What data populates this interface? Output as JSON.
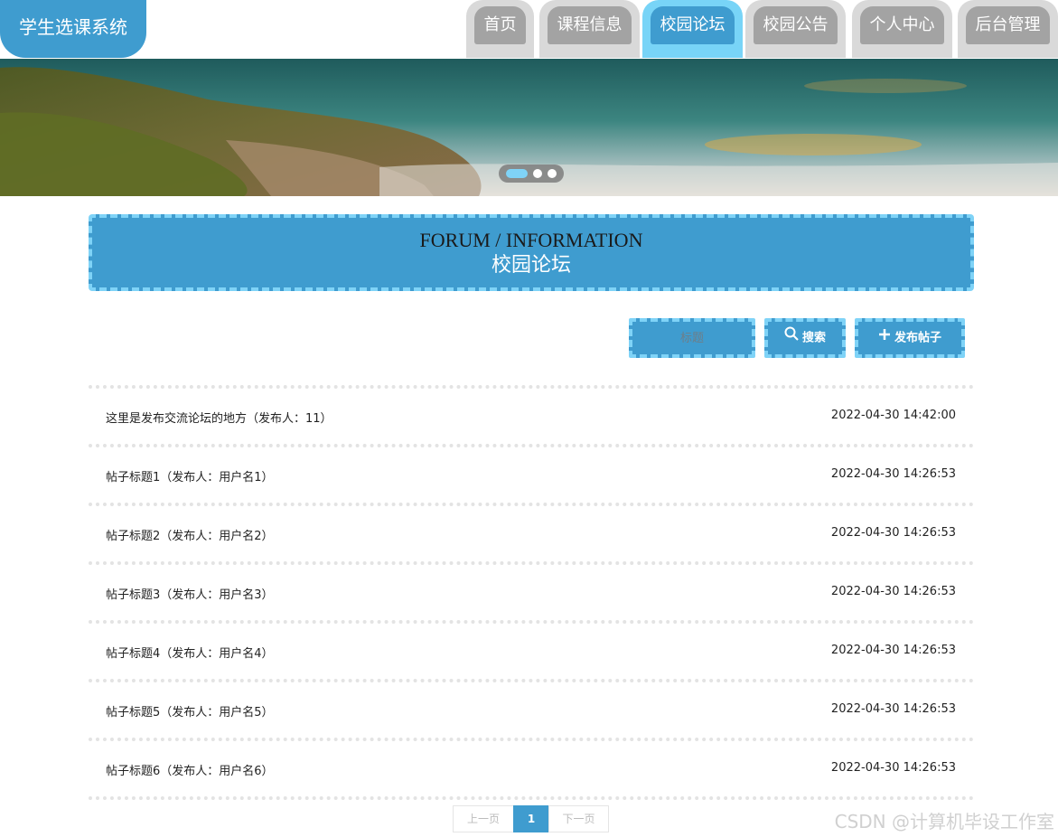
{
  "header": {
    "logo": "学生选课系统",
    "nav": [
      {
        "label": "首页"
      },
      {
        "label": "课程信息"
      },
      {
        "label": "校园论坛",
        "active": true
      },
      {
        "label": "校园公告"
      },
      {
        "label": "个人中心"
      },
      {
        "label": "后台管理"
      }
    ]
  },
  "banner": {
    "slides": 3,
    "active_slide": 1
  },
  "section": {
    "title_en": "FORUM / INFORMATION",
    "title_cn": "校园论坛"
  },
  "toolbar": {
    "search_placeholder": "标题",
    "search_label": "搜索",
    "add_label": "发布帖子"
  },
  "posts": [
    {
      "title": "这里是发布交流论坛的地方（发布人：11）",
      "time": "2022-04-30 14:42:00"
    },
    {
      "title": "帖子标题1（发布人：用户名1）",
      "time": "2022-04-30 14:26:53"
    },
    {
      "title": "帖子标题2（发布人：用户名2）",
      "time": "2022-04-30 14:26:53"
    },
    {
      "title": "帖子标题3（发布人：用户名3）",
      "time": "2022-04-30 14:26:53"
    },
    {
      "title": "帖子标题4（发布人：用户名4）",
      "time": "2022-04-30 14:26:53"
    },
    {
      "title": "帖子标题5（发布人：用户名5）",
      "time": "2022-04-30 14:26:53"
    },
    {
      "title": "帖子标题6（发布人：用户名6）",
      "time": "2022-04-30 14:26:53"
    }
  ],
  "pagination": {
    "prev": "上一页",
    "current": "1",
    "next": "下一页"
  },
  "watermark": "CSDN @计算机毕设工作室",
  "colors": {
    "primary": "#3f9ccf",
    "accent": "#7fd3f7",
    "nav_inactive": "#a3a3a3"
  }
}
